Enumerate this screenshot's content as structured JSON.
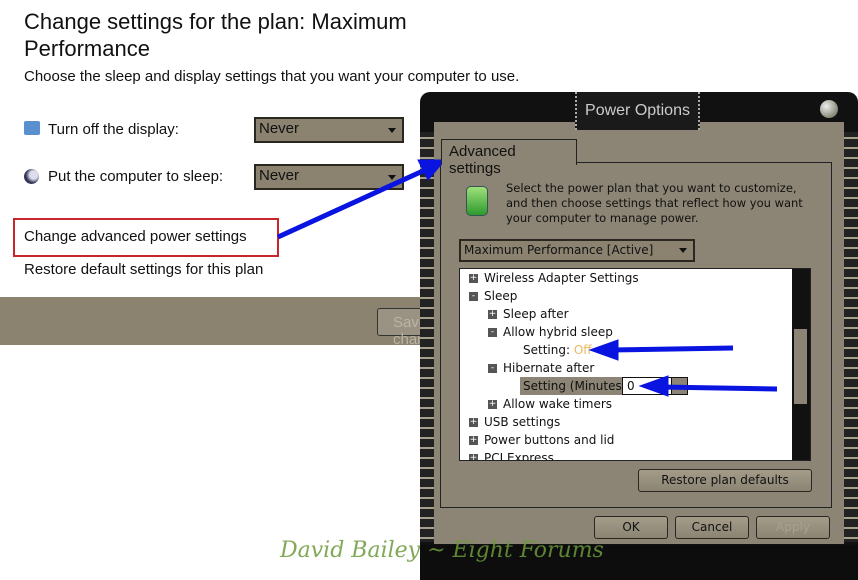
{
  "page": {
    "title": "Change settings for the plan: Maximum Performance",
    "subtitle": "Choose the sleep and display settings that you want your computer to use.",
    "settings": [
      {
        "label": "Turn off the display:",
        "value": "Never",
        "icon": "monitor-clock-icon"
      },
      {
        "label": "Put the computer to sleep:",
        "value": "Never",
        "icon": "moon-icon"
      }
    ],
    "links": {
      "advanced": "Change advanced power settings",
      "restore": "Restore default settings for this plan"
    },
    "save_label": "Save changes"
  },
  "dialog": {
    "title": "Power Options",
    "tab": "Advanced settings",
    "description": "Select the power plan that you want to customize, and then choose settings that reflect how you want your computer to manage power.",
    "plan": "Maximum Performance [Active]",
    "tree": [
      {
        "label": "Wireless Adapter Settings",
        "expander": "+"
      },
      {
        "label": "Sleep",
        "expander": "-"
      },
      {
        "label": "Sleep after",
        "expander": "+"
      },
      {
        "label": "Allow hybrid sleep",
        "expander": "-"
      },
      {
        "label": "Setting:",
        "value": "Off"
      },
      {
        "label": "Hibernate after",
        "expander": "-"
      },
      {
        "label": "Setting (Minutes):",
        "value": "0"
      },
      {
        "label": "Allow wake timers",
        "expander": "+"
      },
      {
        "label": "USB settings",
        "expander": "+"
      },
      {
        "label": "Power buttons and lid",
        "expander": "+"
      },
      {
        "label": "PCI Express",
        "expander": "+"
      }
    ],
    "restore_defaults": "Restore plan defaults",
    "ok": "OK",
    "cancel": "Cancel",
    "apply": "Apply"
  },
  "watermark": "David Bailey ~ Eight Forums",
  "colors": {
    "accent_arrow": "#0a14e0",
    "highlight_box": "#c8262b",
    "theme": "#8c8474",
    "off_value": "#e8b860"
  }
}
